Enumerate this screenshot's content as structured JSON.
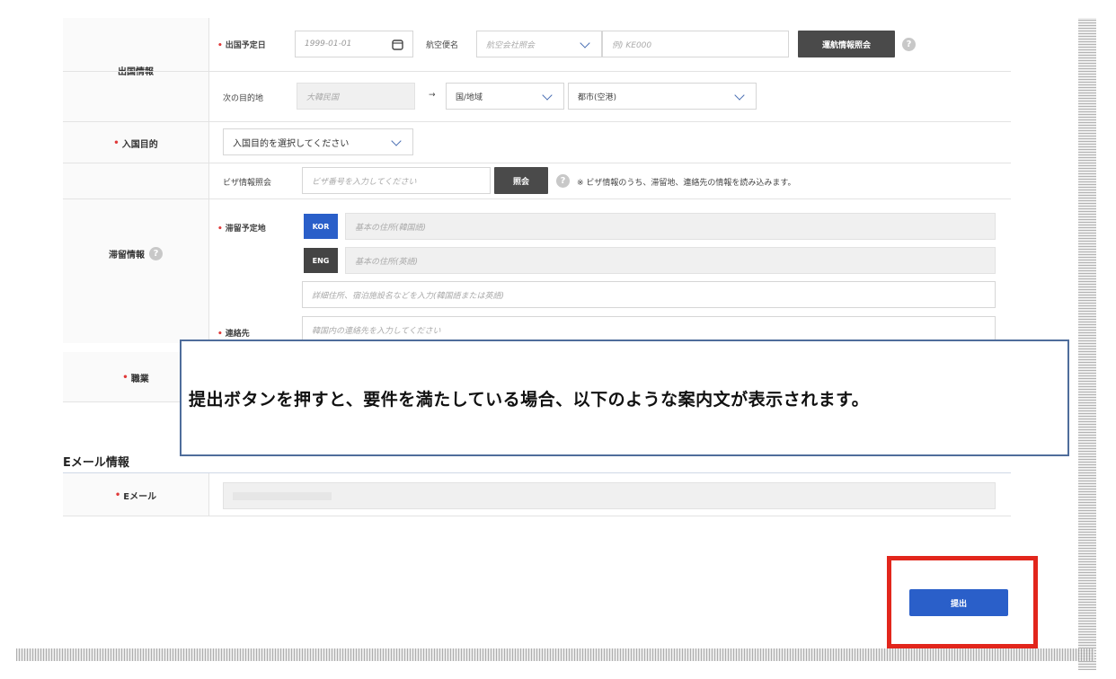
{
  "departure": {
    "section_label": "出国情報",
    "date_label": "出国予定日",
    "date_value": "1999-01-01",
    "flight_label": "航空便名",
    "airline_placeholder": "航空会社照会",
    "flight_placeholder": "例) KE000",
    "lookup_button": "運航情報照会",
    "next_dest_label": "次の目的地",
    "next_dest_value": "大韓民国",
    "arrow": "→",
    "country_select": "国/地域",
    "city_select": "都市(空港)"
  },
  "purpose": {
    "label": "入国目的",
    "select_value": "入国目的を選択してください"
  },
  "stay": {
    "section_label": "滞留情報",
    "visa_label": "ビザ情報照会",
    "visa_placeholder": "ビザ番号を入力してください",
    "visa_button": "照会",
    "visa_note": "※ ビザ情報のうち、滞留地、連絡先の情報を読み込みます。",
    "address_label": "滞留予定地",
    "kor_tag": "KOR",
    "kor_placeholder": "基本の住所(韓国語)",
    "eng_tag": "ENG",
    "eng_placeholder": "基本の住所(英語)",
    "detail_placeholder": "詳細住所、宿泊施設名などを入力(韓国語または英語)",
    "contact_label": "連絡先",
    "contact_placeholder": "韓国内の連絡先を入力してください"
  },
  "job": {
    "label": "職業"
  },
  "callout_text": "提出ボタンを押すと、要件を満たしている場合、以下のような案内文が表示されます。",
  "email": {
    "section_title": "Eメール情報",
    "label": "Eメール"
  },
  "submit_label": "提出",
  "help_glyph": "?",
  "colors": {
    "submit": "#2a5fc9",
    "highlight": "#e2261c",
    "required": "#e03a3a",
    "kor_tag": "#2a5fc9"
  }
}
